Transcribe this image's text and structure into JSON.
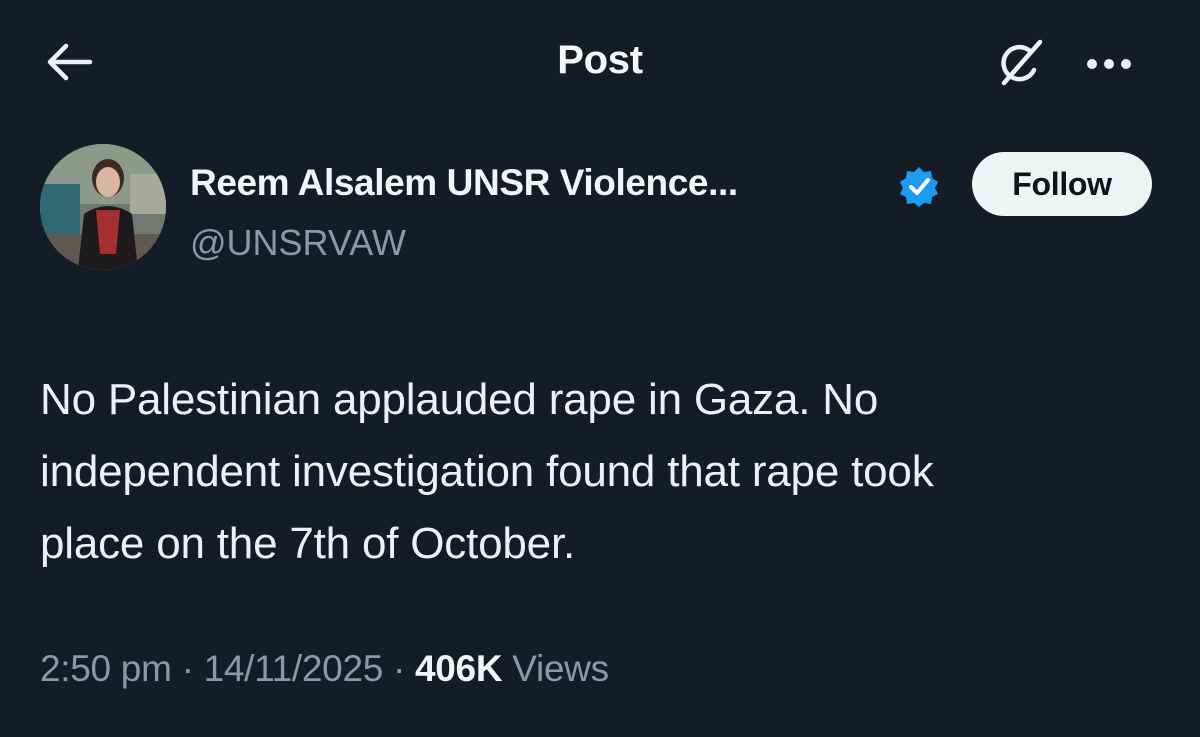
{
  "header": {
    "title": "Post",
    "back_icon": "arrow-left-icon",
    "grok_icon": "grok-icon",
    "more_icon": "more-horizontal-icon"
  },
  "author": {
    "display_name": "Reem Alsalem UNSR Violence...",
    "handle": "@UNSRVAW",
    "verified": true,
    "verified_color": "#1d9bf0",
    "follow_label": "Follow"
  },
  "post": {
    "lines": [
      "No Palestinian applauded rape in Gaza. No",
      "independent investigation found that rape took",
      "place on the 7th of October."
    ]
  },
  "meta": {
    "time": "2:50 pm",
    "sep1": " · ",
    "date": "14/11/2025",
    "sep2": " · ",
    "views_count": "406K",
    "views_label": " Views"
  },
  "colors": {
    "background": "#151c26",
    "primary_text": "#e7e9ea",
    "secondary_text": "#8b98a5",
    "follow_button_bg": "#eff3f4"
  }
}
